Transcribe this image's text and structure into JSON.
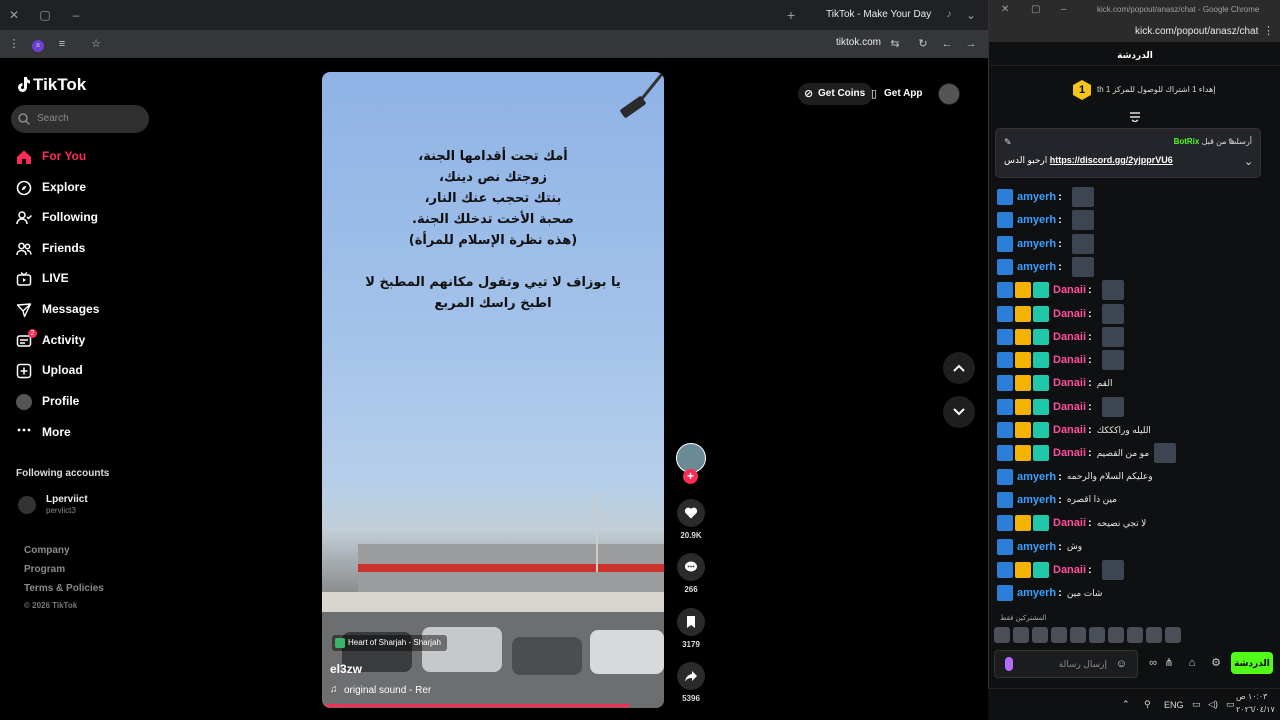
{
  "browser": {
    "active_tab_title": "TikTok - Make Your Day",
    "new_tab_symbol": "+",
    "address": "tiktok.com",
    "profile_initial": "a"
  },
  "tiktok": {
    "logo_text": "TikTok",
    "search_placeholder": "Search",
    "nav": [
      {
        "label": "For You",
        "icon": "home-icon"
      },
      {
        "label": "Explore",
        "icon": "compass-icon"
      },
      {
        "label": "Following",
        "icon": "following-icon"
      },
      {
        "label": "Friends",
        "icon": "friends-icon"
      },
      {
        "label": "LIVE",
        "icon": "live-icon"
      },
      {
        "label": "Messages",
        "icon": "messages-icon"
      },
      {
        "label": "Activity",
        "icon": "activity-icon",
        "badge": "2"
      },
      {
        "label": "Upload",
        "icon": "upload-icon"
      },
      {
        "label": "Profile",
        "icon": "profile-icon"
      },
      {
        "label": "More",
        "icon": "more-icon"
      }
    ],
    "following_heading": "Following accounts",
    "following_account": {
      "name": "Lperviict",
      "handle": "perviict3"
    },
    "footer": [
      "Company",
      "Program",
      "Terms & Policies"
    ],
    "copyright": "© 2026 TikTok",
    "get_coins": "Get Coins",
    "get_app": "Get App",
    "video": {
      "overlay_text": "أمك تحت أقدامها الجنة،\nزوجتك نص دينك،\nبنتك تحجب عنك النار،\nصحبة الأخت تدخلك الجنة.\n(هذه نظرة الإسلام للمرأة)\n\nيا بوزاف لا تيي وتقول مكانهم المطبخ لا\nاطبخ راسك المربع",
      "location": "Heart of Sharjah - Sharjah",
      "author": "el3zw",
      "sound": "original sound - Rer"
    },
    "actions": {
      "likes": "20.9K",
      "comments": "266",
      "saves": "3179",
      "shares": "5396"
    }
  },
  "kick": {
    "window_title": "kick.com/popout/anasz/chat - Google Chrome",
    "url": "kick.com/popout/anasz/chat",
    "chat_header": "الدردشة",
    "sub_goal_number": "1",
    "sub_goal_text": "th إهداء 1 اشتراك للوصول للمركز 1",
    "pinned": {
      "pinned_by": "أرسلت من قبل",
      "bot_name": "BotRix",
      "message_prefix": "ارحبو الدس",
      "link": "https://discord.gg/2yjpprVU6"
    },
    "messages": [
      {
        "user": "amyerh",
        "color": "#3aa0ff",
        "badges": [
          "kick"
        ],
        "text": "",
        "emote": true
      },
      {
        "user": "amyerh",
        "color": "#3aa0ff",
        "badges": [
          "kick"
        ],
        "text": "",
        "emote": true
      },
      {
        "user": "amyerh",
        "color": "#3aa0ff",
        "badges": [
          "kick"
        ],
        "text": "",
        "emote": true
      },
      {
        "user": "amyerh",
        "color": "#3aa0ff",
        "badges": [
          "kick"
        ],
        "text": "",
        "emote": true
      },
      {
        "user": "Danaii",
        "color": "#ff4fa0",
        "badges": [
          "kick",
          "crown",
          "sub"
        ],
        "text": "",
        "emote": true
      },
      {
        "user": "Danaii",
        "color": "#ff4fa0",
        "badges": [
          "kick",
          "crown",
          "sub"
        ],
        "text": "",
        "emote": true
      },
      {
        "user": "Danaii",
        "color": "#ff4fa0",
        "badges": [
          "kick",
          "crown",
          "sub"
        ],
        "text": "",
        "emote": true
      },
      {
        "user": "Danaii",
        "color": "#ff4fa0",
        "badges": [
          "kick",
          "crown",
          "sub"
        ],
        "text": "",
        "emote": true
      },
      {
        "user": "Danaii",
        "color": "#ff4fa0",
        "badges": [
          "kick",
          "crown",
          "sub"
        ],
        "text": "القم",
        "emote": false
      },
      {
        "user": "Danaii",
        "color": "#ff4fa0",
        "badges": [
          "kick",
          "crown",
          "sub"
        ],
        "text": "",
        "emote": true
      },
      {
        "user": "Danaii",
        "color": "#ff4fa0",
        "badges": [
          "kick",
          "crown",
          "sub"
        ],
        "text": "الليله وراكككك",
        "emote": false
      },
      {
        "user": "Danaii",
        "color": "#ff4fa0",
        "badges": [
          "kick",
          "crown",
          "sub"
        ],
        "text": "مو من القصيم",
        "emote": true
      },
      {
        "user": "amyerh",
        "color": "#3aa0ff",
        "badges": [
          "kick"
        ],
        "text": "وعليكم السلام والرحمه",
        "emote": false
      },
      {
        "user": "amyerh",
        "color": "#3aa0ff",
        "badges": [
          "kick"
        ],
        "text": "مين ذا اقصره",
        "emote": false
      },
      {
        "user": "Danaii",
        "color": "#ff4fa0",
        "badges": [
          "kick",
          "crown",
          "sub"
        ],
        "text": "لا تجي نصيحه",
        "emote": false
      },
      {
        "user": "amyerh",
        "color": "#3aa0ff",
        "badges": [
          "kick"
        ],
        "text": "وش",
        "emote": false
      },
      {
        "user": "Danaii",
        "color": "#ff4fa0",
        "badges": [
          "kick",
          "crown",
          "sub"
        ],
        "text": "",
        "emote": true
      },
      {
        "user": "amyerh",
        "color": "#3aa0ff",
        "badges": [
          "kick"
        ],
        "text": "شات مين",
        "emote": false
      }
    ],
    "emote_bar_label": "المشتركين فقط",
    "input_placeholder": "إرسال رسالة",
    "send_label": "الدردشة"
  },
  "taskbar": {
    "lang": "ENG",
    "time": "١٠:٠٣ ص",
    "date": "٢٠٢٦/٠٤/١٧"
  }
}
